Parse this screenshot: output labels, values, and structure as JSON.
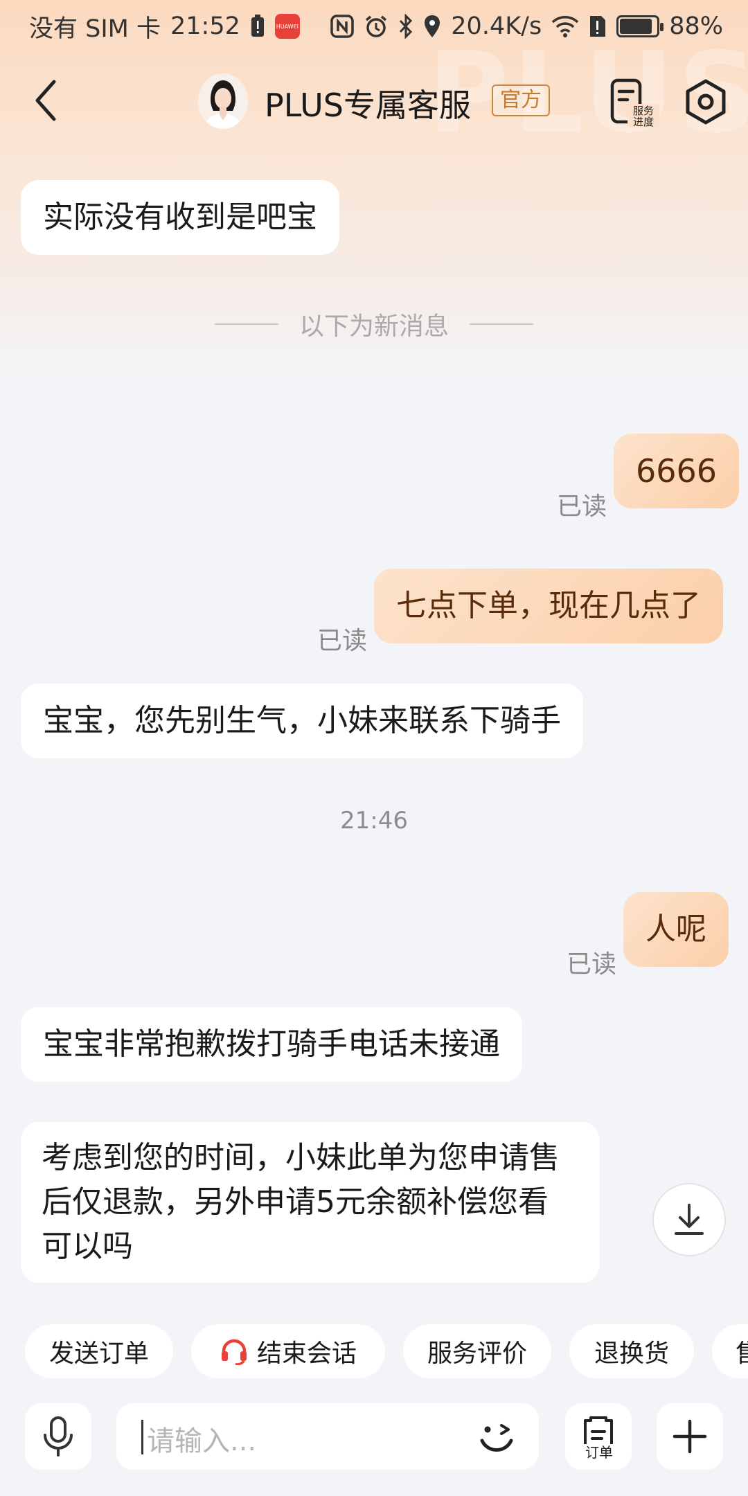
{
  "status_bar": {
    "carrier": "没有 SIM 卡",
    "time": "21:52",
    "net_speed": "20.4K/s",
    "battery": "88%",
    "battery_level": 0.88
  },
  "header": {
    "title": "PLUS专属客服",
    "badge": "官方",
    "progress_label_line1": "服务",
    "progress_label_line2": "进度",
    "watermark": "PLUS"
  },
  "messages": {
    "m1": "实际没有收到是吧宝",
    "divider": "以下为新消息",
    "m2": "6666",
    "m2_read": "已读",
    "m3": "七点下单，现在几点了",
    "m3_read": "已读",
    "m4": "宝宝，您先别生气，小妹来联系下骑手",
    "time": "21:46",
    "m5": "人呢",
    "m5_read": "已读",
    "m6": "宝宝非常抱歉拨打骑手电话未接通",
    "m7_line1": "考虑到您的时间，小妹此单为您申请售",
    "m7_line2": "后仅退款，另外申请5元余额补偿您看",
    "m7_line3": "可以吗"
  },
  "quick_actions": [
    "发送订单",
    "结束会话",
    "服务评价",
    "退换货",
    "售"
  ],
  "input": {
    "placeholder": "请输入...",
    "order_label": "订单"
  },
  "colors": {
    "accent": "#c67a2e",
    "out_bubble": "#fbd6b5",
    "headset_icon": "#e8413a"
  }
}
